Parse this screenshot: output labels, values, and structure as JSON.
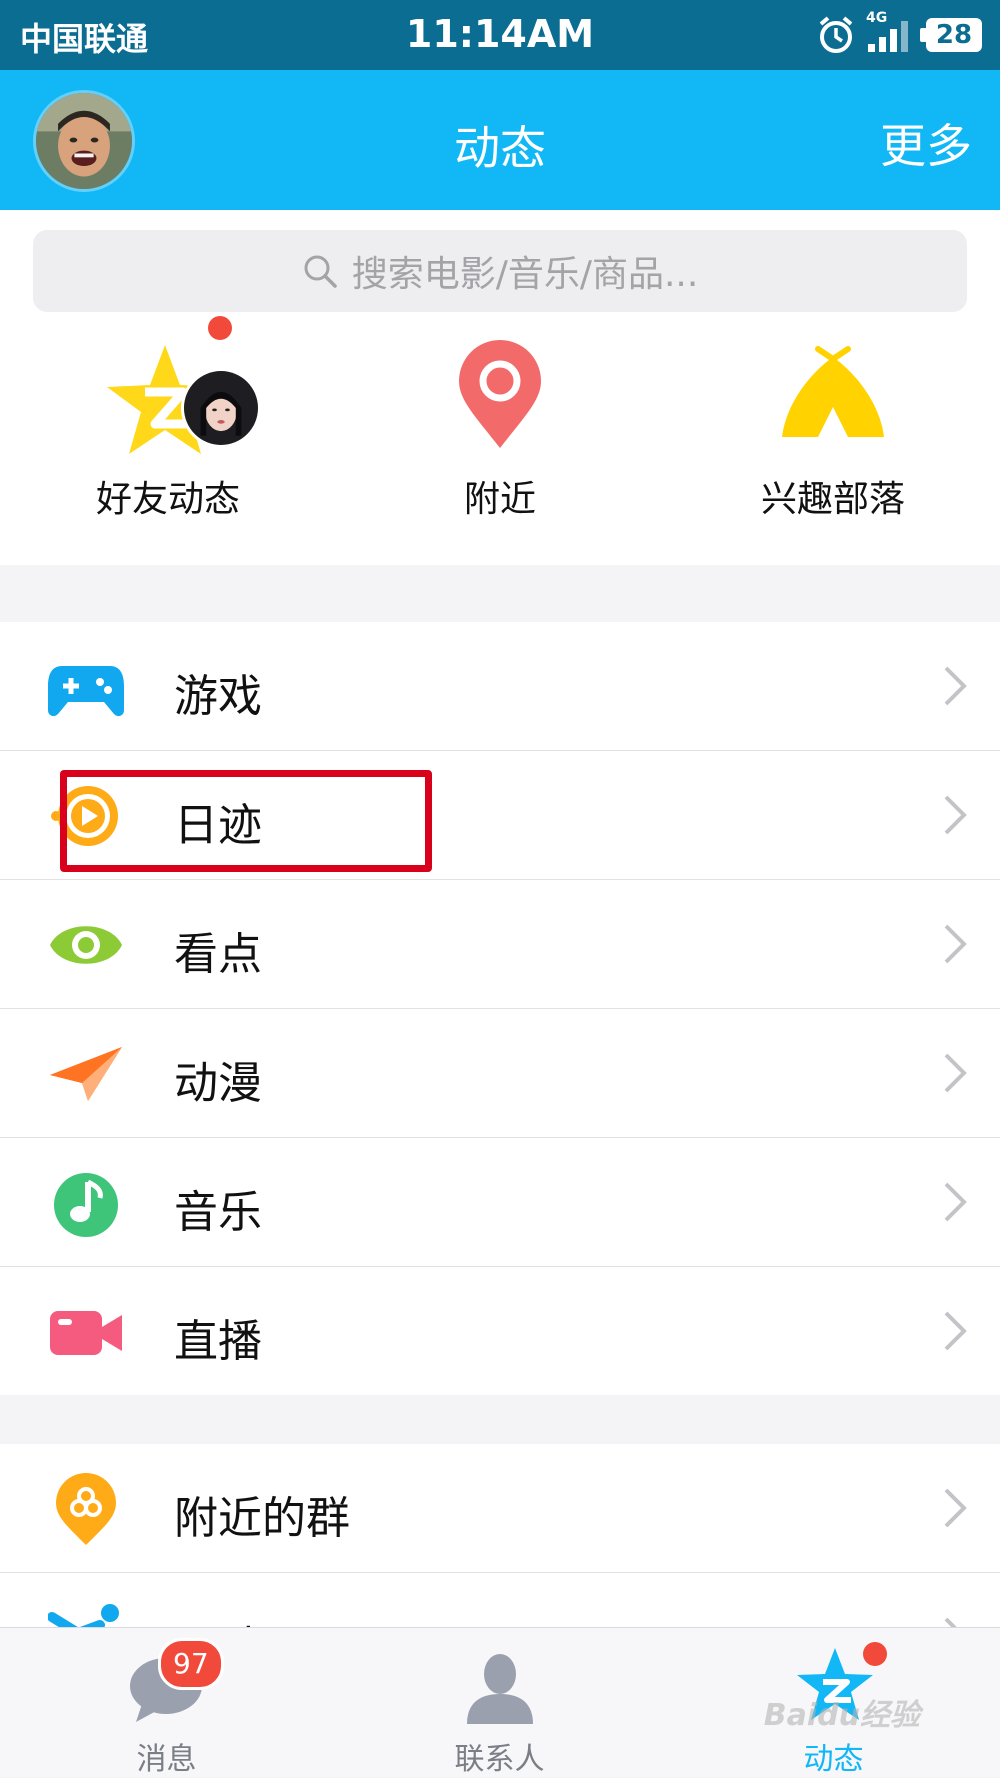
{
  "status_bar": {
    "carrier": "中国联通",
    "time": "11:14AM",
    "network": "4G",
    "battery": "28"
  },
  "header": {
    "title": "动态",
    "more": "更多"
  },
  "search": {
    "placeholder": "搜索电影/音乐/商品..."
  },
  "quick_entries": [
    {
      "label": "好友动态",
      "icon": "qzone-star-icon"
    },
    {
      "label": "附近",
      "icon": "location-pin-icon"
    },
    {
      "label": "兴趣部落",
      "icon": "tent-icon"
    }
  ],
  "list_group1": [
    {
      "label": "游戏",
      "icon": "gamepad-icon",
      "color": "#12a8ef"
    },
    {
      "label": "日迹",
      "icon": "play-circle-icon",
      "color": "#ffaa17"
    },
    {
      "label": "看点",
      "icon": "eye-icon",
      "color": "#8ccb35"
    },
    {
      "label": "动漫",
      "icon": "paper-plane-icon",
      "color": "#ff8a3a"
    },
    {
      "label": "音乐",
      "icon": "music-note-icon",
      "color": "#3ec57a"
    },
    {
      "label": "直播",
      "icon": "video-camera-icon",
      "color": "#f55b7e"
    }
  ],
  "list_group2": [
    {
      "label": "附近的群",
      "icon": "group-pin-icon",
      "color": "#ffaa17"
    },
    {
      "label": "运动",
      "icon": "sport-icon",
      "color": "#12a8ef"
    }
  ],
  "tab_bar": {
    "messages": {
      "label": "消息",
      "badge": "97"
    },
    "contacts": {
      "label": "联系人"
    },
    "activity": {
      "label": "动态"
    }
  },
  "watermark": "Baidu经验",
  "colors": {
    "status_bar": "#0b6d92",
    "nav_bar": "#12b7f5",
    "highlight_box": "#d9001b",
    "badge": "#f24a3a"
  }
}
